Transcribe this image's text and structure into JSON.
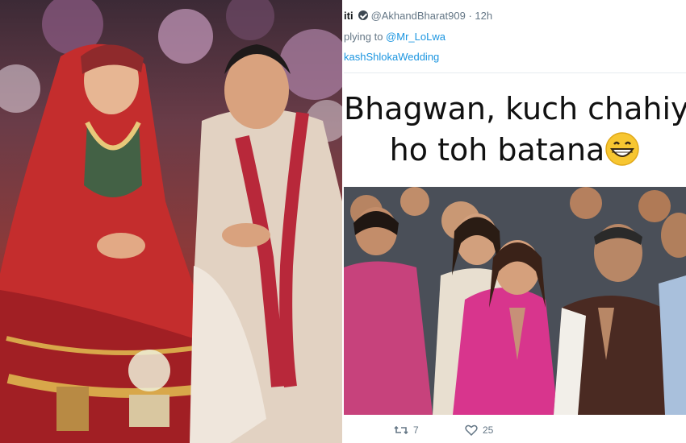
{
  "tweet": {
    "display_name_fragment": "iti",
    "handle": "@AkhandBharat909",
    "time": "12h",
    "replying_prefix": "plying to",
    "replying_to": "@Mr_LoLwa",
    "hashtag": "kashShlokaWedding",
    "meme_text_line1": "Bhagwan, kuch chahiye",
    "meme_text_line2": "ho toh batana",
    "retweets": "7",
    "likes": "25"
  },
  "colors": {
    "link": "#1b95e0",
    "muted": "#657786"
  },
  "icons": {
    "emoji": "grinning-face-icon",
    "retweet": "retweet-icon",
    "like": "heart-icon"
  }
}
